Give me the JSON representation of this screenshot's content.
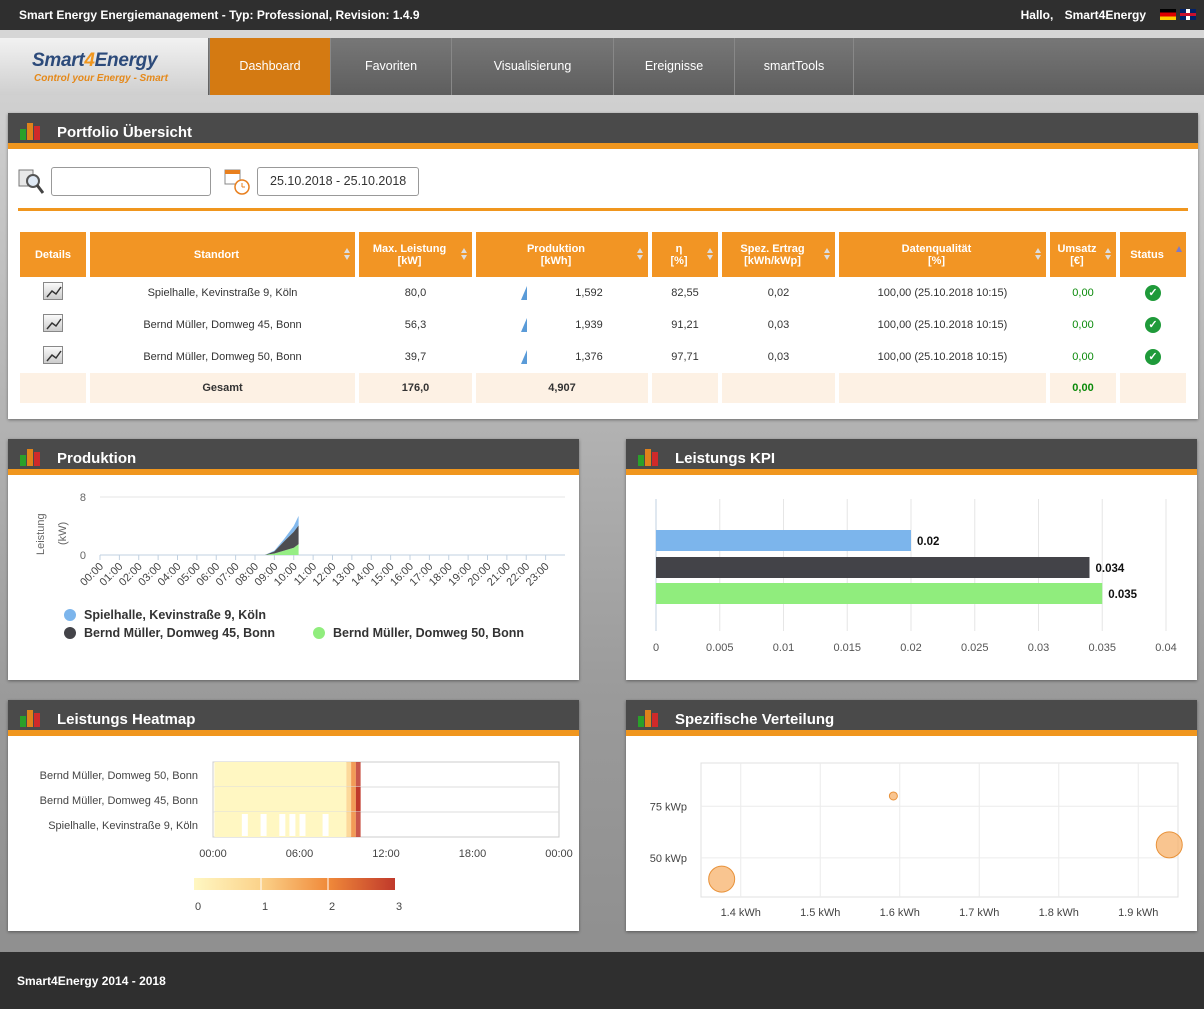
{
  "topbar": {
    "app_title": "Smart Energy Energiemanagement - Typ: Professional, Revision: 1.4.9",
    "greeting": "Hallo,",
    "user": "Smart4Energy"
  },
  "logo": {
    "brand_a": "Smart",
    "brand_b": "4",
    "brand_c": "Energy",
    "slogan": "Control your Energy - Smart"
  },
  "nav": {
    "items": [
      {
        "label": "Dashboard"
      },
      {
        "label": "Favoriten"
      },
      {
        "label": "Visualisierung"
      },
      {
        "label": "Ereignisse"
      },
      {
        "label": "smartTools"
      }
    ],
    "active": "Dashboard"
  },
  "portfolio": {
    "title": "Portfolio Übersicht",
    "filter_value": "",
    "date_range": "25.10.2018 - 25.10.2018",
    "columns": [
      {
        "line1": "Details",
        "line2": ""
      },
      {
        "line1": "Standort",
        "line2": ""
      },
      {
        "line1": "Max. Leistung",
        "line2": "[kW]"
      },
      {
        "line1": "Produktion",
        "line2": "[kWh]"
      },
      {
        "line1": "η",
        "line2": "[%]"
      },
      {
        "line1": "Spez. Ertrag",
        "line2": "[kWh/kWp]"
      },
      {
        "line1": "Datenqualität",
        "line2": "[%]"
      },
      {
        "line1": "Umsatz",
        "line2": "[€]"
      },
      {
        "line1": "Status",
        "line2": ""
      }
    ],
    "rows": [
      {
        "standort": "Spielhalle, Kevinstraße 9, Köln",
        "max_leistung": "80,0",
        "produktion": "1,592",
        "eta": "82,55",
        "spez_ertrag": "0,02",
        "datenqualitaet": "100,00 (25.10.2018 10:15)",
        "umsatz": "0,00",
        "status": "ok"
      },
      {
        "standort": "Bernd Müller, Domweg 45, Bonn",
        "max_leistung": "56,3",
        "produktion": "1,939",
        "eta": "91,21",
        "spez_ertrag": "0,03",
        "datenqualitaet": "100,00 (25.10.2018 10:15)",
        "umsatz": "0,00",
        "status": "ok"
      },
      {
        "standort": "Bernd Müller, Domweg 50, Bonn",
        "max_leistung": "39,7",
        "produktion": "1,376",
        "eta": "97,71",
        "spez_ertrag": "0,03",
        "datenqualitaet": "100,00 (25.10.2018 10:15)",
        "umsatz": "0,00",
        "status": "ok"
      }
    ],
    "total": {
      "label": "Gesamt",
      "max_leistung": "176,0",
      "produktion": "4,907",
      "umsatz": "0,00"
    }
  },
  "produktion": {
    "title": "Produktion",
    "chart_data": {
      "type": "area",
      "ylabel": "Leistung (kW)",
      "ylim": [
        0,
        8
      ],
      "yticks": [
        "8",
        "0"
      ],
      "x": [
        "00:00",
        "01:00",
        "02:00",
        "03:00",
        "04:00",
        "05:00",
        "06:00",
        "07:00",
        "08:00",
        "09:00",
        "10:00",
        "11:00",
        "12:00",
        "13:00",
        "14:00",
        "15:00",
        "16:00",
        "17:00",
        "18:00",
        "19:00",
        "20:00",
        "21:00",
        "22:00",
        "23:00"
      ],
      "stacked": true,
      "series": [
        {
          "name": "Bernd Müller, Domweg 50, Bonn",
          "color": "#90ed7d",
          "x_hours": [
            8.5,
            9.0,
            9.5,
            10.0,
            10.25
          ],
          "values": [
            0,
            0.2,
            0.6,
            1.0,
            1.5
          ]
        },
        {
          "name": "Bernd Müller, Domweg 45, Bonn",
          "color": "#434348",
          "x_hours": [
            8.5,
            9.0,
            9.5,
            10.0,
            10.25
          ],
          "values": [
            0,
            0.3,
            1.3,
            2.2,
            2.6
          ]
        },
        {
          "name": "Spielhalle, Kevinstraße 9, Köln",
          "color": "#7cb5ec",
          "x_hours": [
            8.5,
            9.0,
            9.5,
            10.0,
            10.25
          ],
          "values": [
            0,
            0.1,
            0.3,
            0.8,
            1.3
          ]
        }
      ],
      "legend": "bottom"
    }
  },
  "kpi": {
    "title": "Leistungs KPI",
    "chart_data": {
      "type": "bar",
      "orientation": "horizontal",
      "xlim": [
        0,
        0.04
      ],
      "ticks": [
        "0",
        "0.005",
        "0.01",
        "0.015",
        "0.02",
        "0.025",
        "0.03",
        "0.035",
        "0.04"
      ],
      "series": [
        {
          "value": 0.02,
          "label": "0.02",
          "color": "#7cb5ec"
        },
        {
          "value": 0.034,
          "label": "0.034",
          "color": "#434348"
        },
        {
          "value": 0.035,
          "label": "0.035",
          "color": "#90ed7d"
        }
      ]
    }
  },
  "heatmap": {
    "title": "Leistungs Heatmap",
    "chart_data": {
      "type": "heatmap",
      "rows": [
        "Bernd Müller, Domweg 50, Bonn",
        "Bernd Müller, Domweg 45, Bonn",
        "Spielhalle, Kevinstraße 9, Köln"
      ],
      "x_ticks": [
        "00:00",
        "06:00",
        "12:00",
        "18:00",
        "00:00"
      ],
      "color_scale": [
        "#fff7c2",
        "#fbd28a",
        "#f08a3a",
        "#c0392b"
      ],
      "scale_ticks": [
        "0",
        "1",
        "2",
        "3"
      ],
      "data_hours": [
        0.0,
        10.25
      ]
    }
  },
  "verteilung": {
    "title": "Spezifische Verteilung",
    "chart_data": {
      "type": "scatter",
      "bubble": true,
      "x_ticks": [
        "1.4 kWh",
        "1.5 kWh",
        "1.6 kWh",
        "1.7 kWh",
        "1.8 kWh",
        "1.9 kWh"
      ],
      "y_ticks": [
        "75 kWp",
        "50 kWp"
      ],
      "xlim": [
        1.35,
        1.95
      ],
      "ylim": [
        31,
        96
      ],
      "points": [
        {
          "x": 1.376,
          "y": 39.7,
          "size": "large"
        },
        {
          "x": 1.592,
          "y": 80.0,
          "size": "small"
        },
        {
          "x": 1.939,
          "y": 56.3,
          "size": "large"
        }
      ],
      "color": "#f7b26b"
    }
  },
  "footer": {
    "text": "Smart4Energy 2014 - 2018"
  }
}
